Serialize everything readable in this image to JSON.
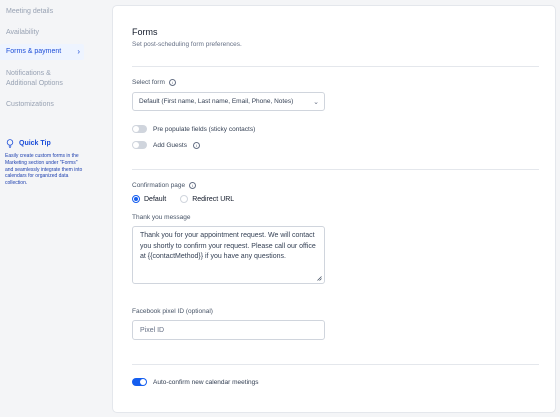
{
  "sidebar": {
    "items": [
      {
        "label": "Meeting details"
      },
      {
        "label": "Availability"
      },
      {
        "label": "Forms & payment"
      },
      {
        "label": "Notifications &"
      },
      {
        "label": "Additional Options"
      },
      {
        "label": "Customizations"
      }
    ],
    "active_chevron": "›",
    "quick_tip": {
      "title": "Quick Tip",
      "text": "Easily create custom forms in the Marketing section under \"Forms\" and seamlessly integrate them into calendars for organized data collection."
    }
  },
  "forms": {
    "title": "Forms",
    "subtitle": "Set post-scheduling form preferences.",
    "select_form_label": "Select form",
    "select_form_value": "Default (First name, Last name, Email, Phone, Notes)",
    "prepopulate_label": "Pre populate fields (sticky contacts)",
    "prepopulate_on": false,
    "add_guests_label": "Add Guests",
    "add_guests_on": false,
    "confirmation_label": "Confirmation page",
    "confirmation_options": [
      "Default",
      "Redirect URL"
    ],
    "confirmation_selected": "Default",
    "thank_you_label": "Thank you message",
    "thank_you_message": "Thank you for your appointment request. We will contact you shortly to confirm your request. Please call our office at {{contactMethod}} if you have any questions.",
    "pixel_label": "Facebook pixel ID (optional)",
    "pixel_placeholder": "Pixel ID",
    "auto_confirm_label": "Auto-confirm new calendar meetings",
    "auto_confirm_on": true
  },
  "colors": {
    "accent": "#155eef",
    "sidebar_active_bg": "#eef4ff",
    "tip_text": "#1e40af"
  }
}
